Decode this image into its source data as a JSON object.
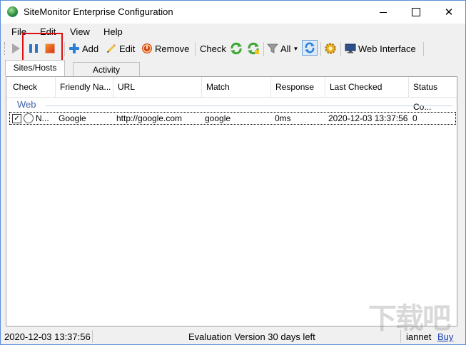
{
  "window": {
    "title": "SiteMonitor Enterprise Configuration"
  },
  "menu": {
    "items": [
      "File",
      "Edit",
      "View",
      "Help"
    ]
  },
  "toolbar": {
    "add": "Add",
    "edit": "Edit",
    "remove": "Remove",
    "check": "Check",
    "filter": "All",
    "web_interface": "Web Interface",
    "icons": [
      "play-icon",
      "pause-icon",
      "stop-icon",
      "add-icon",
      "pencil-icon",
      "remove-icon",
      "refresh-icon",
      "refresh-all-icon",
      "filter-icon",
      "sync-icon",
      "settings-icon",
      "monitor-icon"
    ]
  },
  "tabs": [
    "Sites/Hosts",
    "Activity"
  ],
  "table": {
    "columns": [
      "Check",
      "Friendly Na...",
      "URL",
      "Match",
      "Response",
      "Last Checked",
      "Status Co..."
    ],
    "group": "Web",
    "rows": [
      {
        "check": "N...",
        "name": "Google",
        "url": "http://google.com",
        "match": "google",
        "response": "0ms",
        "last_checked": "2020-12-03 13:37:56",
        "status": "0"
      }
    ]
  },
  "status": {
    "time": "2020-12-03 13:37:56",
    "eval": "Evaluation Version 30 days left",
    "user": "iannet",
    "buy": "Buy"
  },
  "watermark": "下载吧",
  "colors": {
    "highlight": "#e01010",
    "group": "#3f5fa8",
    "link": "#1a3fb0"
  }
}
